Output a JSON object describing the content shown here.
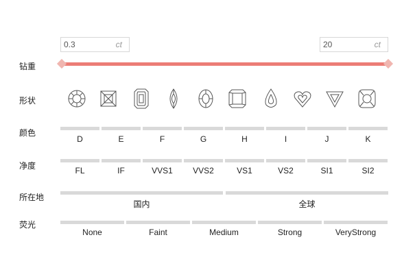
{
  "carat": {
    "label": "钻重",
    "min_value": "0.3",
    "max_value": "20",
    "unit": "ct",
    "range_fill_fraction": [
      0,
      1
    ]
  },
  "shape": {
    "label": "形状",
    "items": [
      {
        "icon": "round-diamond-icon"
      },
      {
        "icon": "princess-diamond-icon"
      },
      {
        "icon": "emerald-diamond-icon"
      },
      {
        "icon": "marquise-diamond-icon"
      },
      {
        "icon": "oval-diamond-icon"
      },
      {
        "icon": "radiant-diamond-icon"
      },
      {
        "icon": "pear-diamond-icon"
      },
      {
        "icon": "heart-diamond-icon"
      },
      {
        "icon": "trillion-diamond-icon"
      },
      {
        "icon": "cushion-diamond-icon"
      }
    ]
  },
  "color": {
    "label": "颜色",
    "options": [
      "D",
      "E",
      "F",
      "G",
      "H",
      "I",
      "J",
      "K"
    ]
  },
  "clarity": {
    "label": "净度",
    "options": [
      "FL",
      "IF",
      "VVS1",
      "VVS2",
      "VS1",
      "VS2",
      "SI1",
      "SI2"
    ]
  },
  "location": {
    "label": "所在地",
    "options": [
      "国内",
      "全球"
    ]
  },
  "fluorescence": {
    "label": "荧光",
    "options": [
      "None",
      "Faint",
      "Medium",
      "Strong",
      "VeryStrong"
    ]
  },
  "colors": {
    "slider": "#ec7d76",
    "handle": "#f0b6b0",
    "bar": "#d9d9d9"
  }
}
